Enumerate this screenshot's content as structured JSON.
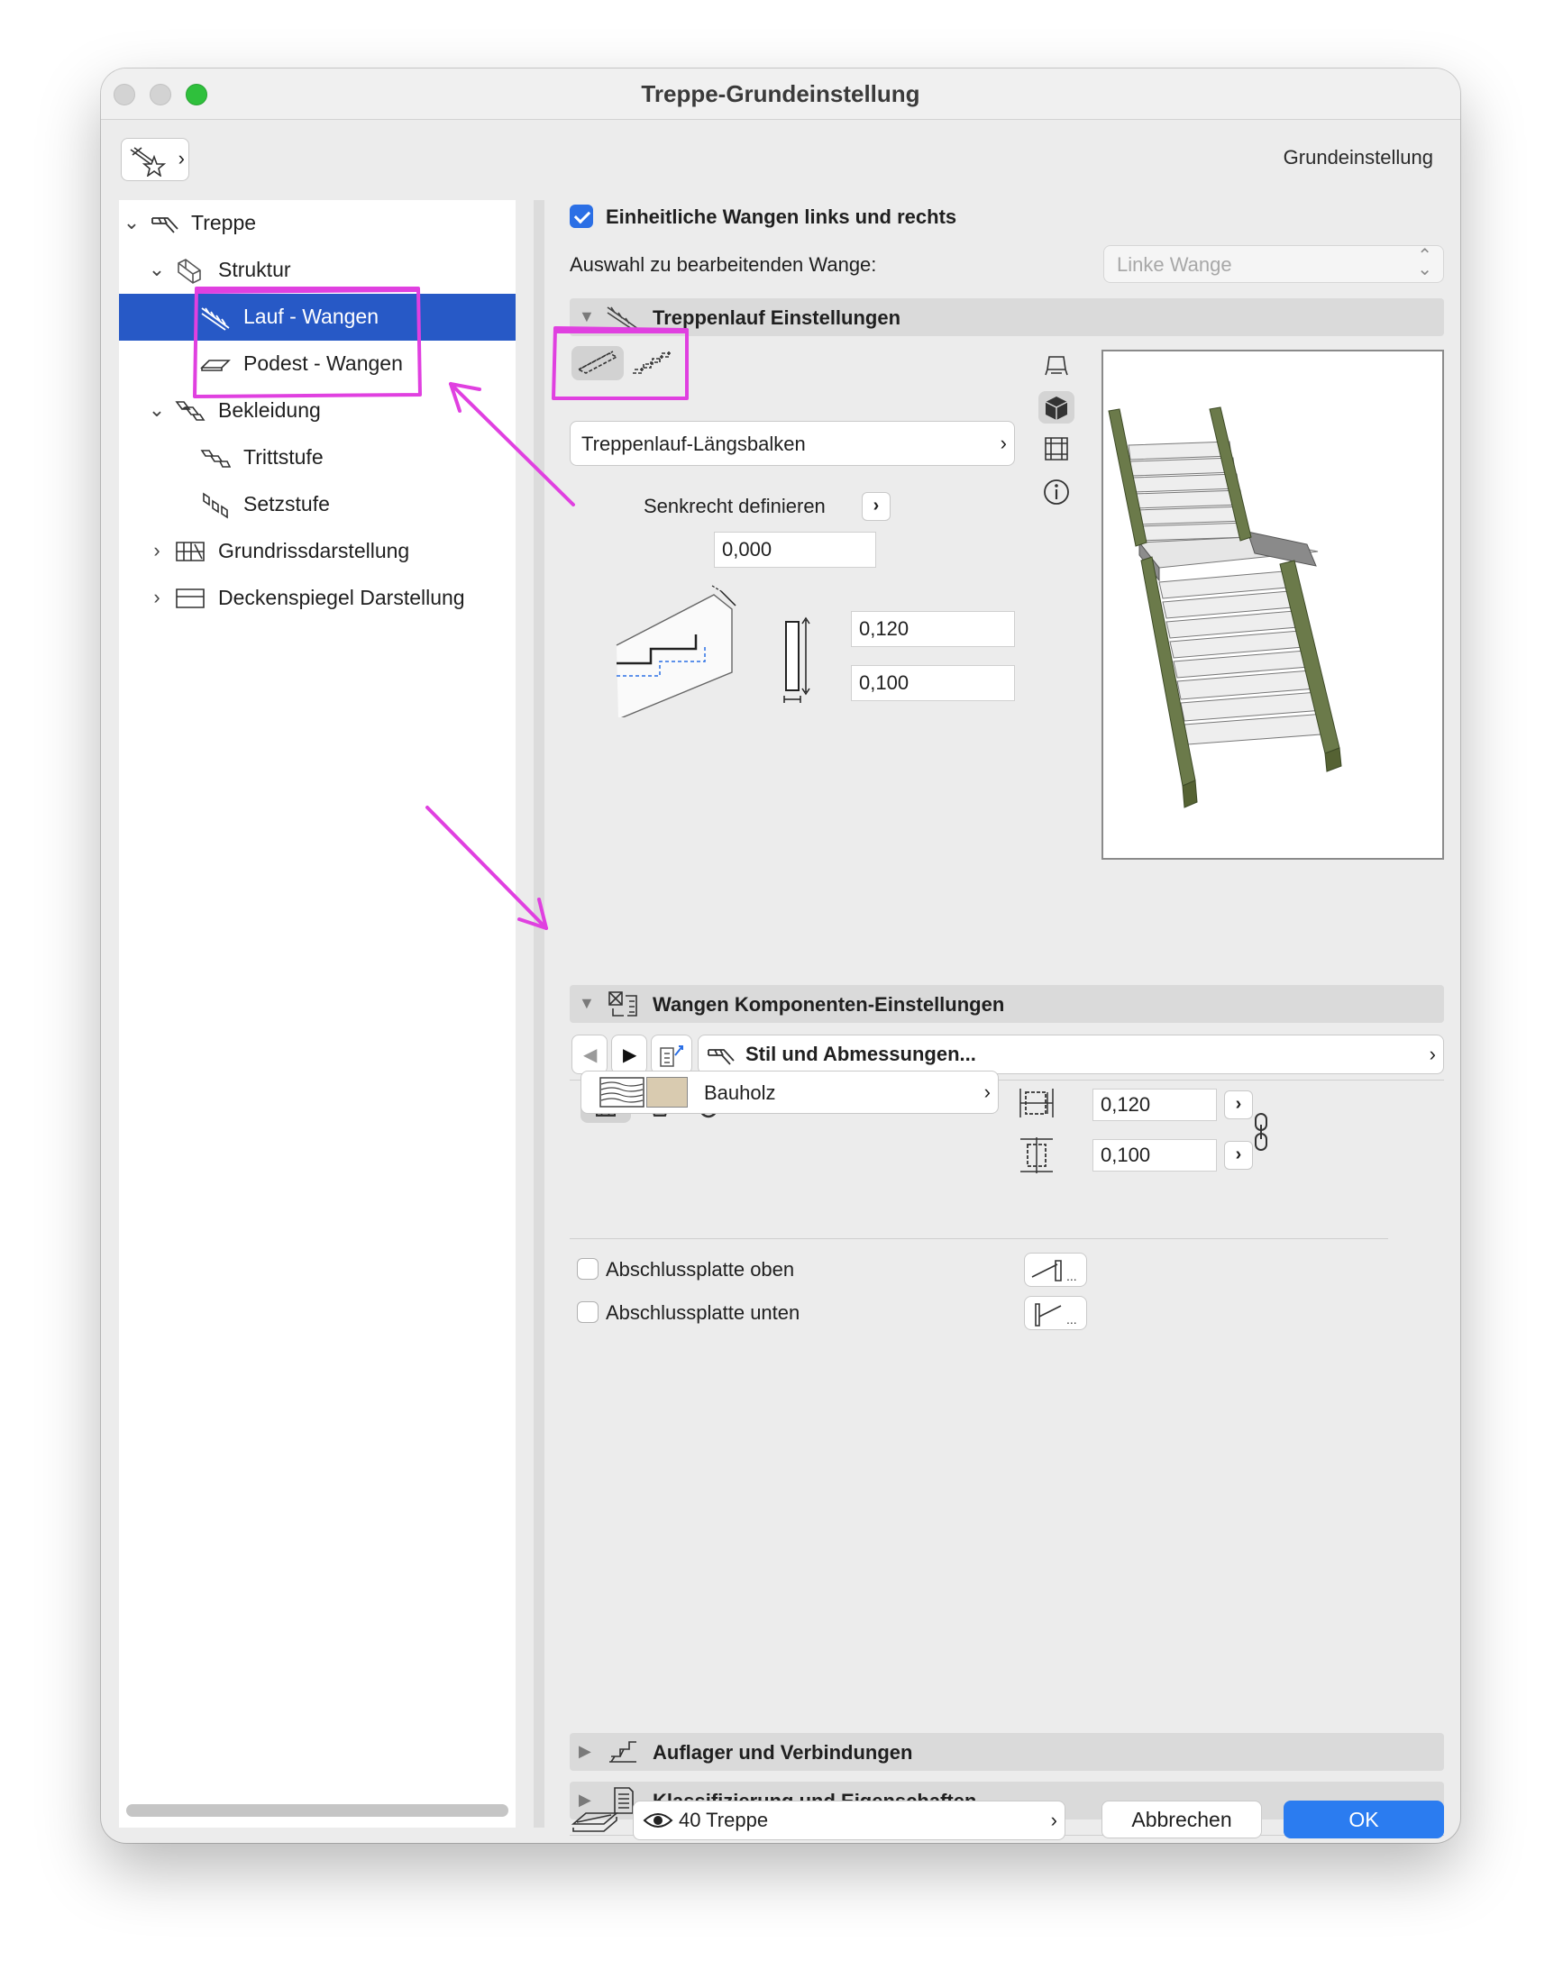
{
  "window": {
    "title": "Treppe-Grundeinstellung",
    "header_right": "Grundeinstellung"
  },
  "tree": {
    "items": [
      {
        "label": "Treppe",
        "expanded": "open",
        "icon": "stair-icon"
      },
      {
        "label": "Struktur",
        "expanded": "open",
        "icon": "structure-icon"
      },
      {
        "label": "Lauf - Wangen",
        "selected": true,
        "icon": "stringer-run-icon"
      },
      {
        "label": "Podest - Wangen",
        "icon": "landing-icon"
      },
      {
        "label": "Bekleidung",
        "expanded": "open",
        "icon": "cladding-icon"
      },
      {
        "label": "Trittstufe",
        "icon": "tread-icon"
      },
      {
        "label": "Setzstufe",
        "icon": "riser-icon"
      },
      {
        "label": "Grundrissdarstellung",
        "expanded": "closed",
        "icon": "floorplan-icon"
      },
      {
        "label": "Deckenspiegel Darstellung",
        "expanded": "closed",
        "icon": "ceiling-icon"
      }
    ]
  },
  "main": {
    "uniform_checkbox_label": "Einheitliche Wangen links und rechts",
    "uniform_checked": true,
    "edit_select_label": "Auswahl zu bearbeitenden Wange:",
    "edit_select_value": "Linke Wange",
    "run_section": {
      "title": "Treppenlauf Einstellungen",
      "type_button": "Treppenlauf-Längsbalken",
      "vertical_label": "Senkrecht definieren",
      "vertical_value": "0,000",
      "height_value": "0,120",
      "width_value": "0,100"
    },
    "components_section": {
      "title": "Wangen Komponenten-Einstellungen",
      "style_button": "Stil und Abmessungen...",
      "material": "Bauholz",
      "dim1": "0,120",
      "dim2": "0,100",
      "end_top_label": "Abschlussplatte oben",
      "end_bottom_label": "Abschlussplatte unten",
      "end_top_checked": false,
      "end_bottom_checked": false
    },
    "collapsed_sections": [
      {
        "title": "Auflager und Verbindungen"
      },
      {
        "title": "Klassifizierung und Eigenschaften"
      }
    ]
  },
  "footer": {
    "layer": "40 Treppe",
    "cancel": "Abbrechen",
    "ok": "OK"
  },
  "colors": {
    "selection": "#2759c6",
    "accent": "#2b7cf0",
    "annotation": "#e040e0",
    "stringer_wood": "#6b7a4a"
  },
  "icons": [
    "close-icon",
    "minimize-icon",
    "zoom-icon",
    "favorites-icon",
    "chevron-right-icon",
    "chevron-down-icon",
    "info-icon",
    "eye-icon",
    "link-icon",
    "floorplan-view-icon",
    "3d-view-icon",
    "section-view-icon"
  ]
}
